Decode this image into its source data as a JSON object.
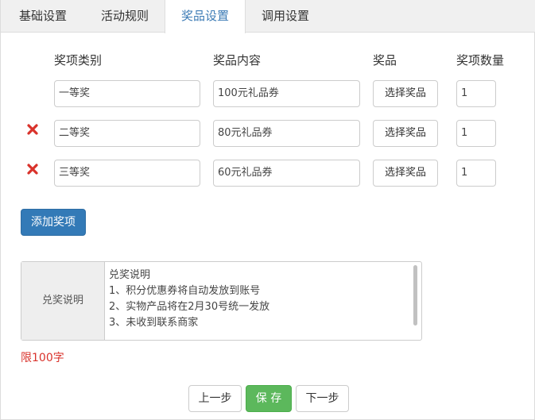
{
  "tabs": [
    {
      "label": "基础设置",
      "active": false
    },
    {
      "label": "活动规则",
      "active": false
    },
    {
      "label": "奖品设置",
      "active": true
    },
    {
      "label": "调用设置",
      "active": false
    }
  ],
  "columns": {
    "category": "奖项类别",
    "content": "奖品内容",
    "prize": "奖品",
    "quantity": "奖项数量"
  },
  "rows": [
    {
      "category": "一等奖",
      "content": "100元礼品券",
      "choose_label": "选择奖品",
      "quantity": "1",
      "deletable": false
    },
    {
      "category": "二等奖",
      "content": "80元礼品券",
      "choose_label": "选择奖品",
      "quantity": "1",
      "deletable": true
    },
    {
      "category": "三等奖",
      "content": "60元礼品券",
      "choose_label": "选择奖品",
      "quantity": "1",
      "deletable": true
    }
  ],
  "add_button": "添加奖项",
  "redeem": {
    "label": "兑奖说明",
    "lines": [
      "兑奖说明",
      "1、积分优惠券将自动发放到账号",
      "2、实物产品将在2月30号统一发放",
      "3、未收到联系商家"
    ]
  },
  "limit_text": "限100字",
  "nav": {
    "prev": "上一步",
    "save": "保 存",
    "next": "下一步"
  },
  "colors": {
    "primary": "#337ab7",
    "success": "#5cb85c",
    "danger": "#d9322b",
    "active_tab": "#3c7bb5"
  },
  "icons": {
    "delete": "red-x-icon"
  }
}
